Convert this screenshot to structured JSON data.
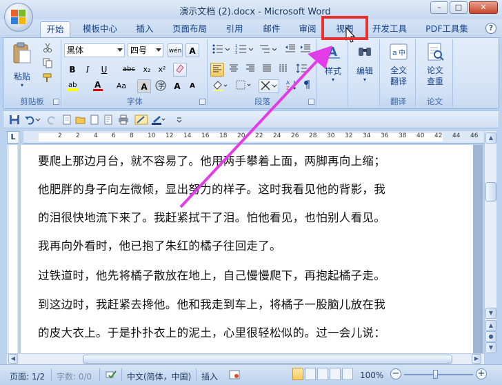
{
  "window": {
    "title": "演示文档 (2).docx - Microsoft Word",
    "minimize": "–",
    "maximize": "□",
    "close": "✕"
  },
  "tabs": [
    {
      "label": "开始",
      "active": true
    },
    {
      "label": "模板中心",
      "active": false
    },
    {
      "label": "插入",
      "active": false
    },
    {
      "label": "页面布局",
      "active": false
    },
    {
      "label": "引用",
      "active": false
    },
    {
      "label": "邮件",
      "active": false
    },
    {
      "label": "审阅",
      "active": false
    },
    {
      "label": "视图",
      "active": false,
      "highlighted": true
    },
    {
      "label": "开发工具",
      "active": false
    },
    {
      "label": "PDF工具集",
      "active": false
    }
  ],
  "help_icon": "?",
  "ribbon": {
    "clipboard": {
      "label": "剪贴板",
      "paste": "粘贴"
    },
    "font": {
      "label": "字体",
      "font_name": "黑体",
      "font_size": "四号",
      "bold": "B",
      "italic": "I",
      "underline": "U",
      "strikethrough": "abc",
      "subscript": "x₂",
      "superscript": "x²",
      "grow": "A",
      "shrink": "A",
      "change_case": "Aa",
      "wen": "wén"
    },
    "paragraph": {
      "label": "段落"
    },
    "styles": {
      "label": "样式"
    },
    "editing": {
      "label": "编辑"
    },
    "translate": {
      "label": "翻译",
      "button": "全文\n翻译"
    },
    "paper": {
      "label": "论文",
      "button": "论文\n查重"
    }
  },
  "ruler_corner": "L",
  "ruler_numbers": [
    "2",
    "2",
    "4",
    "6",
    "8",
    "10",
    "12",
    "14",
    "16",
    "18",
    "20",
    "22",
    "24",
    "26",
    "28",
    "30",
    "32",
    "34",
    "36",
    "38",
    "40",
    "42",
    "44",
    "46",
    "48"
  ],
  "document": {
    "lines": [
      "要爬上那边月台，就不容易了。他用两手攀着上面，两脚再向上缩；",
      "他肥胖的身子向左微倾，显出努力的样子。这时我看见他的背影，我",
      "的泪很快地流下来了。我赶紧拭干了泪。怕他看见，也怕别人看见。",
      "我再向外看时，他已抱了朱红的橘子往回走了。",
      "过铁道时，他先将橘子散放在地上，自己慢慢爬下，再抱起橘子走。",
      "到这边时，我赶紧去搀他。他和我走到车上，将橘子一股脑儿放在我",
      "的皮大衣上。于是扑扑衣上的泥土，心里很轻松似的。过一会儿说："
    ]
  },
  "status_bar": {
    "page": "页面: 1/2",
    "word_count": "字数: 0/0",
    "language": "中文(简体，中国)",
    "insert_mode": "插入",
    "zoom": "100%"
  },
  "colors": {
    "highlight_border": "#e8322f",
    "arrow": "#e23be8",
    "ribbon_bg": "#dbe7f7"
  }
}
